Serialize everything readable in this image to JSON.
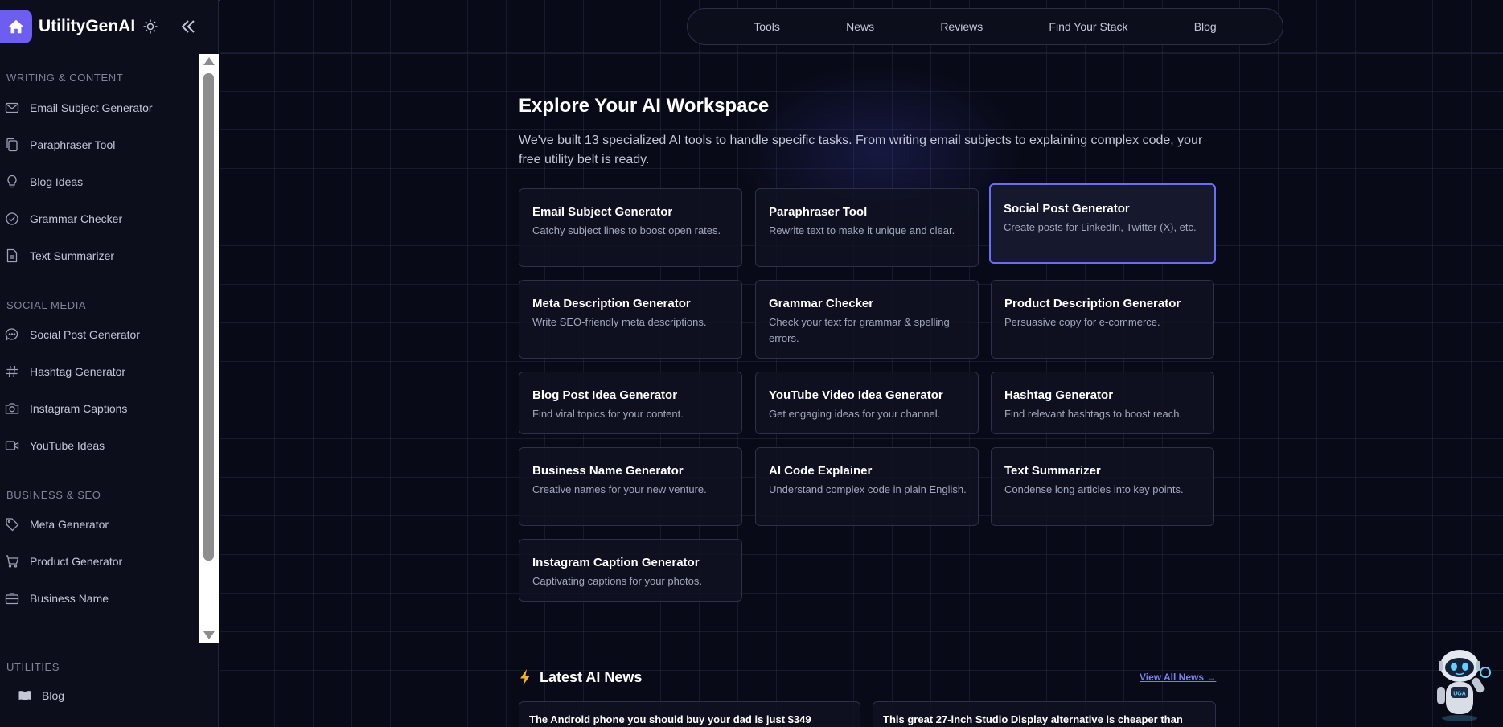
{
  "brand": {
    "name": "UtilityGenAI"
  },
  "sidebar": {
    "sections": [
      {
        "title": "WRITING & CONTENT",
        "items": [
          {
            "label": "Email Subject Generator",
            "icon": "mail-icon"
          },
          {
            "label": "Paraphraser Tool",
            "icon": "copy-icon"
          },
          {
            "label": "Blog Ideas",
            "icon": "lightbulb-icon"
          },
          {
            "label": "Grammar Checker",
            "icon": "check-circle-icon"
          },
          {
            "label": "Text Summarizer",
            "icon": "document-icon"
          }
        ]
      },
      {
        "title": "SOCIAL MEDIA",
        "items": [
          {
            "label": "Social Post Generator",
            "icon": "chat-bubble-icon"
          },
          {
            "label": "Hashtag Generator",
            "icon": "hash-icon"
          },
          {
            "label": "Instagram Captions",
            "icon": "camera-icon"
          },
          {
            "label": "YouTube Ideas",
            "icon": "video-icon"
          }
        ]
      },
      {
        "title": "BUSINESS & SEO",
        "items": [
          {
            "label": "Meta Generator",
            "icon": "tag-icon"
          },
          {
            "label": "Product Generator",
            "icon": "cart-icon"
          },
          {
            "label": "Business Name",
            "icon": "briefcase-icon"
          }
        ]
      }
    ],
    "utilities": {
      "title": "UTILITIES",
      "items": [
        {
          "label": "Blog",
          "icon": "book-icon"
        }
      ]
    }
  },
  "topnav": {
    "items": [
      "Tools",
      "News",
      "Reviews",
      "Find Your Stack",
      "Blog"
    ]
  },
  "hero": {
    "title": "Explore Your AI Workspace",
    "intro": "We've built 13 specialized AI tools to handle specific tasks. From writing email subjects to explaining complex code, your free utility belt is ready."
  },
  "tools": [
    {
      "title": "Email Subject Generator",
      "desc": "Catchy subject lines to boost open rates."
    },
    {
      "title": "Paraphraser Tool",
      "desc": "Rewrite text to make it unique and clear."
    },
    {
      "title": "Social Post Generator",
      "desc": "Create posts for LinkedIn, Twitter (X), etc."
    },
    {
      "title": "Meta Description Generator",
      "desc": "Write SEO-friendly meta descriptions."
    },
    {
      "title": "Grammar Checker",
      "desc": "Check your text for grammar & spelling errors."
    },
    {
      "title": "Product Description Generator",
      "desc": "Persuasive copy for e-commerce."
    },
    {
      "title": "Blog Post Idea Generator",
      "desc": "Find viral topics for your content."
    },
    {
      "title": "YouTube Video Idea Generator",
      "desc": "Get engaging ideas for your channel."
    },
    {
      "title": "Hashtag Generator",
      "desc": "Find relevant hashtags to boost reach."
    },
    {
      "title": "Business Name Generator",
      "desc": "Creative names for your new venture."
    },
    {
      "title": "AI Code Explainer",
      "desc": "Understand complex code in plain English."
    },
    {
      "title": "Text Summarizer",
      "desc": "Condense long articles into key points."
    },
    {
      "title": "Instagram Caption Generator",
      "desc": "Captivating captions for your photos."
    }
  ],
  "news": {
    "title": "Latest AI News",
    "view_all": "View All News →",
    "items": [
      "The Android phone you should buy your dad is just $349",
      "This great 27-inch Studio Display alternative is cheaper than"
    ]
  },
  "colors": {
    "accent": "#6d5ef2",
    "background": "#080a17",
    "active_border": "#6b6ef5",
    "link": "#7b80f0"
  },
  "mascot": {
    "badge": "UGA"
  }
}
